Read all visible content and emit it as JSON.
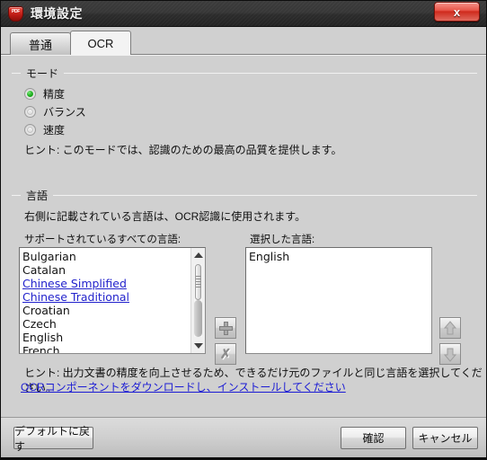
{
  "window": {
    "title": "環境設定",
    "app_icon": "pdf-document-icon",
    "close_label": "x"
  },
  "tabs": [
    {
      "label": "普通",
      "active": false,
      "name": "tab-general"
    },
    {
      "label": "OCR",
      "active": true,
      "name": "tab-ocr"
    }
  ],
  "mode_group": {
    "title": "モード",
    "options": [
      {
        "label": "精度",
        "selected": true
      },
      {
        "label": "バランス",
        "selected": false
      },
      {
        "label": "速度",
        "selected": false
      }
    ],
    "hint": "ヒント: このモードでは、認識のための最高の品質を提供します。"
  },
  "language_group": {
    "title": "言語",
    "description": "右側に記載されている言語は、OCR認識に使用されます。",
    "available_label": "サポートされているすべての言語:",
    "selected_label": "選択した言語:",
    "available_languages": [
      {
        "name": "Bulgarian",
        "link": false
      },
      {
        "name": "Catalan",
        "link": false
      },
      {
        "name": "Chinese Simplified",
        "link": true
      },
      {
        "name": "Chinese Traditional",
        "link": true
      },
      {
        "name": "Croatian",
        "link": false
      },
      {
        "name": "Czech",
        "link": false
      },
      {
        "name": "English",
        "link": false
      },
      {
        "name": "French",
        "link": false
      }
    ],
    "selected_languages": [
      {
        "name": "English"
      }
    ],
    "add_button": "add-language-icon",
    "remove_button": "remove-language-icon",
    "move_up_button": "move-up-icon",
    "move_down_button": "move-down-icon",
    "hint": "ヒント: 出力文書の精度を向上させるため、できるだけ元のファイルと同じ言語を選択してください。",
    "download_link": "OCRコンポーネントをダウンロードし、インストールしてください"
  },
  "footer": {
    "restore_defaults": "デフォルトに戻す",
    "confirm": "確認",
    "cancel": "キャンセル"
  },
  "colors": {
    "accent_green": "#27b527",
    "link_blue": "#2222cc",
    "close_red": "#cf2a1d",
    "window_bg": "#d0d0d0"
  }
}
